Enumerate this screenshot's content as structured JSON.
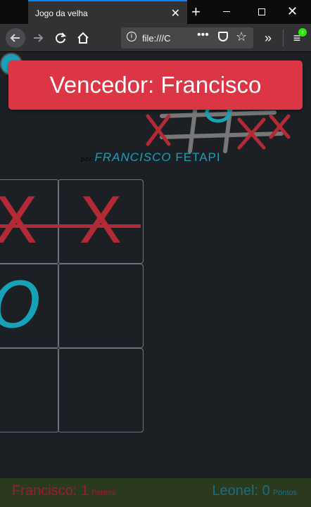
{
  "browser": {
    "tab_title": "Jogo da velha",
    "tab_close": "✕",
    "new_tab": "+",
    "window_close": "✕",
    "url": "file:///C",
    "url_more": "•••",
    "overflow": "»",
    "menu": "≡"
  },
  "page": {
    "byline_prefix": "por:",
    "byline_author": "FRANCISCO",
    "byline_suffix": "FETAPI",
    "alert": "Vencedor: Francisco",
    "board": [
      [
        "X",
        "X"
      ],
      [
        "O",
        ""
      ],
      [
        "",
        ""
      ]
    ],
    "scores": [
      {
        "name": "Francisco",
        "points": "1",
        "unit": "Pontos"
      },
      {
        "name": "Leonel",
        "points": "0",
        "unit": "Pontos"
      }
    ]
  },
  "colors": {
    "x": "#b22a36",
    "o": "#17a2b8",
    "alert": "#dc3545"
  }
}
